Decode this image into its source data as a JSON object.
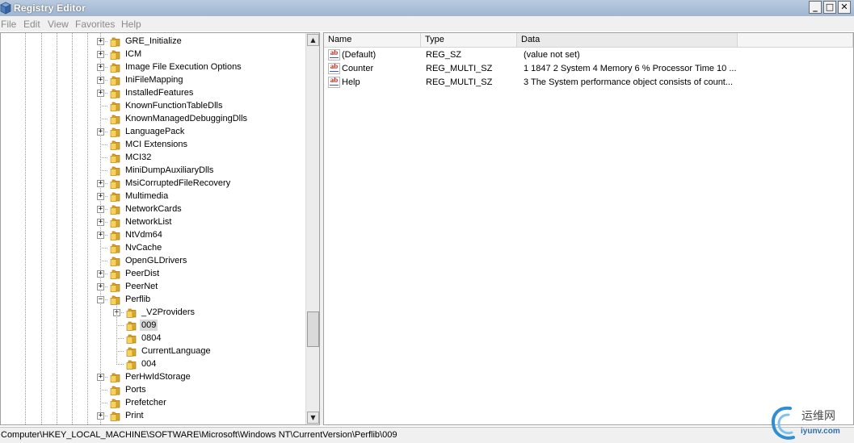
{
  "window": {
    "title": "Registry Editor",
    "minimize": "_",
    "maximize": "□",
    "close": "✕"
  },
  "menu": [
    "File",
    "Edit",
    "View",
    "Favorites",
    "Help"
  ],
  "tree": [
    {
      "label": "GRE_Initialize",
      "depth": 0,
      "expandable": true
    },
    {
      "label": "ICM",
      "depth": 0,
      "expandable": true
    },
    {
      "label": "Image File Execution Options",
      "depth": 0,
      "expandable": true
    },
    {
      "label": "IniFileMapping",
      "depth": 0,
      "expandable": true
    },
    {
      "label": "InstalledFeatures",
      "depth": 0,
      "expandable": true
    },
    {
      "label": "KnownFunctionTableDlls",
      "depth": 0,
      "expandable": false
    },
    {
      "label": "KnownManagedDebuggingDlls",
      "depth": 0,
      "expandable": false
    },
    {
      "label": "LanguagePack",
      "depth": 0,
      "expandable": true
    },
    {
      "label": "MCI Extensions",
      "depth": 0,
      "expandable": false
    },
    {
      "label": "MCI32",
      "depth": 0,
      "expandable": false
    },
    {
      "label": "MiniDumpAuxiliaryDlls",
      "depth": 0,
      "expandable": false
    },
    {
      "label": "MsiCorruptedFileRecovery",
      "depth": 0,
      "expandable": true
    },
    {
      "label": "Multimedia",
      "depth": 0,
      "expandable": true
    },
    {
      "label": "NetworkCards",
      "depth": 0,
      "expandable": true
    },
    {
      "label": "NetworkList",
      "depth": 0,
      "expandable": true
    },
    {
      "label": "NtVdm64",
      "depth": 0,
      "expandable": true
    },
    {
      "label": "NvCache",
      "depth": 0,
      "expandable": false
    },
    {
      "label": "OpenGLDrivers",
      "depth": 0,
      "expandable": false
    },
    {
      "label": "PeerDist",
      "depth": 0,
      "expandable": true
    },
    {
      "label": "PeerNet",
      "depth": 0,
      "expandable": true
    },
    {
      "label": "Perflib",
      "depth": 0,
      "expandable": true,
      "expanded": true
    },
    {
      "label": "_V2Providers",
      "depth": 1,
      "expandable": true
    },
    {
      "label": "009",
      "depth": 1,
      "expandable": false,
      "selected": true
    },
    {
      "label": "0804",
      "depth": 1,
      "expandable": false
    },
    {
      "label": "CurrentLanguage",
      "depth": 1,
      "expandable": false
    },
    {
      "label": "004",
      "depth": 1,
      "expandable": false
    },
    {
      "label": "PerHwIdStorage",
      "depth": 0,
      "expandable": true
    },
    {
      "label": "Ports",
      "depth": 0,
      "expandable": false
    },
    {
      "label": "Prefetcher",
      "depth": 0,
      "expandable": false
    },
    {
      "label": "Print",
      "depth": 0,
      "expandable": true
    }
  ],
  "tree_scroll": {
    "up": "▲",
    "down": "▼"
  },
  "list": {
    "columns": [
      "Name",
      "Type",
      "Data"
    ],
    "rows": [
      {
        "icon": "string-value-icon",
        "icon_text": "ab",
        "name": "(Default)",
        "type": "REG_SZ",
        "data": "(value not set)"
      },
      {
        "icon": "string-value-icon",
        "icon_text": "ab",
        "name": "Counter",
        "type": "REG_MULTI_SZ",
        "data": "1 1847 2 System 4 Memory 6 % Processor Time 10 ..."
      },
      {
        "icon": "string-value-icon",
        "icon_text": "ab",
        "name": "Help",
        "type": "REG_MULTI_SZ",
        "data": "3 The System performance object consists of count..."
      }
    ]
  },
  "status": "Computer\\HKEY_LOCAL_MACHINE\\SOFTWARE\\Microsoft\\Windows NT\\CurrentVersion\\Perflib\\009",
  "watermark": {
    "name": "运维网",
    "url": "iyunv.com"
  }
}
